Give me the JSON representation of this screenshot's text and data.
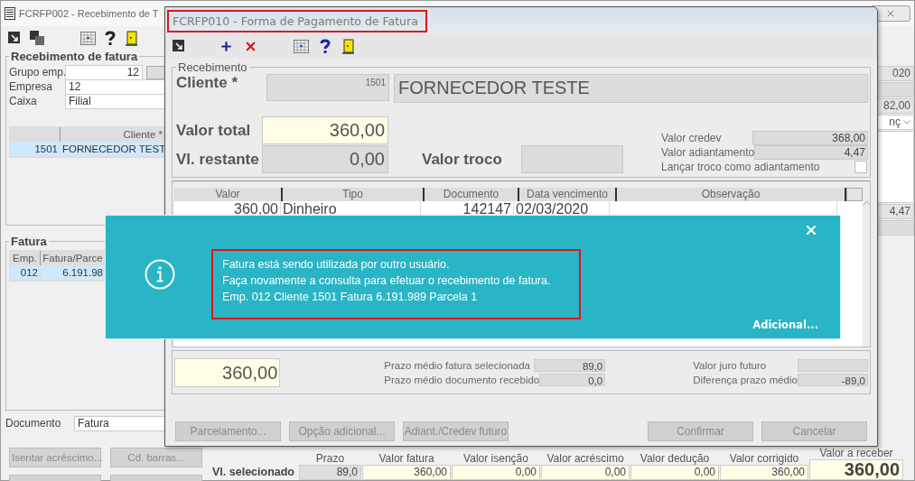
{
  "main_window": {
    "title": "FCRFP002 - Recebimento de T",
    "invoice_receipt": {
      "legend": "Recebimento de fatura",
      "fields": [
        {
          "label": "Grupo emp.",
          "value": "12",
          "kind": "code"
        },
        {
          "label": "Empresa",
          "value": "12",
          "kind": "text"
        },
        {
          "label": "Caixa",
          "value": "Filial",
          "kind": "text"
        }
      ],
      "table": {
        "columns": [
          "",
          "Cliente *"
        ],
        "rows": [
          {
            "cells": [
              "1501",
              "FORNECEDOR TEST"
            ],
            "selected": true
          }
        ]
      }
    },
    "invoice": {
      "legend": "Fatura",
      "columns": [
        "Emp.",
        "Fatura/Parce"
      ],
      "rows": [
        {
          "cells": [
            "012",
            "6.191.98"
          ],
          "selected": true
        }
      ]
    },
    "document": {
      "label": "Documento",
      "value": "Fatura"
    },
    "buttons": [
      "Isentar acréscimo...",
      "Cd. barras..."
    ],
    "right_column": [
      {
        "kind": "cell",
        "text": "020"
      },
      {
        "kind": "header"
      },
      {
        "kind": "cell",
        "text": "82,00"
      },
      {
        "kind": "dropdown",
        "text": "nç"
      },
      {
        "kind": "blank"
      },
      {
        "kind": "cell",
        "text": "4,47"
      },
      {
        "kind": "header"
      }
    ],
    "selected_totals": {
      "label": "Vl. selecionado",
      "columns": [
        {
          "header": "Prazo",
          "value": "89,0",
          "kind": "readonly"
        },
        {
          "header": "Valor fatura",
          "value": "360,00",
          "kind": "input"
        },
        {
          "header": "Valor isenção",
          "value": "0,00",
          "kind": "input"
        },
        {
          "header": "Valor acréscimo",
          "value": "0,00",
          "kind": "input"
        },
        {
          "header": "Valor dedução",
          "value": "0,00",
          "kind": "input"
        },
        {
          "header": "Valor corrigido",
          "value": "360,00",
          "kind": "input"
        },
        {
          "header": "Valor a receber",
          "value": "360,00",
          "kind": "total"
        }
      ]
    }
  },
  "dialog": {
    "title": "FCRFP010 - Forma de Pagamento de Fatura",
    "legend": "Recebimento",
    "client": {
      "label": "Cliente *",
      "code": "1501",
      "name": "FORNECEDOR TESTE"
    },
    "total": {
      "label": "Valor total",
      "value": "360,00"
    },
    "remaining": {
      "label": "Vl. restante",
      "value": "0,00"
    },
    "change": {
      "label": "Valor troco"
    },
    "credits": [
      {
        "label": "Valor credev",
        "value": "368,00"
      },
      {
        "label": "Valor adiantamento",
        "value": "4,47"
      }
    ],
    "change_as_advance": {
      "label": "Lançar troco como adiantamento",
      "checked": false
    },
    "payments": {
      "columns": [
        "Valor",
        "Tipo",
        "Documento",
        "Data vencimento",
        "Observação"
      ],
      "rows": [
        {
          "cells": [
            "360,00",
            "Dinheiro",
            "142147",
            "02/03/2020",
            ""
          ]
        }
      ]
    },
    "sum": "360,00",
    "averages": [
      {
        "label": "Prazo médio fatura selecionada",
        "value": "89,0"
      },
      {
        "label": "Prazo médio documento recebido",
        "value": "0,0"
      }
    ],
    "interest": [
      {
        "label": "Valor juro futuro"
      },
      {
        "label": "Diferença prazo médio",
        "value": "-89,0"
      }
    ],
    "buttons_left": [
      {
        "label": "Parcelamento...",
        "disabled": true
      },
      {
        "label": "Opção adicional...",
        "disabled": true
      },
      {
        "label": "Adiant./Credev futuro",
        "disabled": true
      }
    ],
    "buttons_right": [
      {
        "label": "Confirmar",
        "disabled": true
      },
      {
        "label": "Cancelar",
        "disabled": true
      }
    ]
  },
  "notification": {
    "lines": [
      "Fatura está sendo utilizada por outro usuário.",
      "Faça novamente a consulta para efetuar o recebimento de fatura.",
      "Emp. 012 Cliente 1501 Fatura 6.191.989 Parcela 1"
    ],
    "link": "Adicional..."
  }
}
